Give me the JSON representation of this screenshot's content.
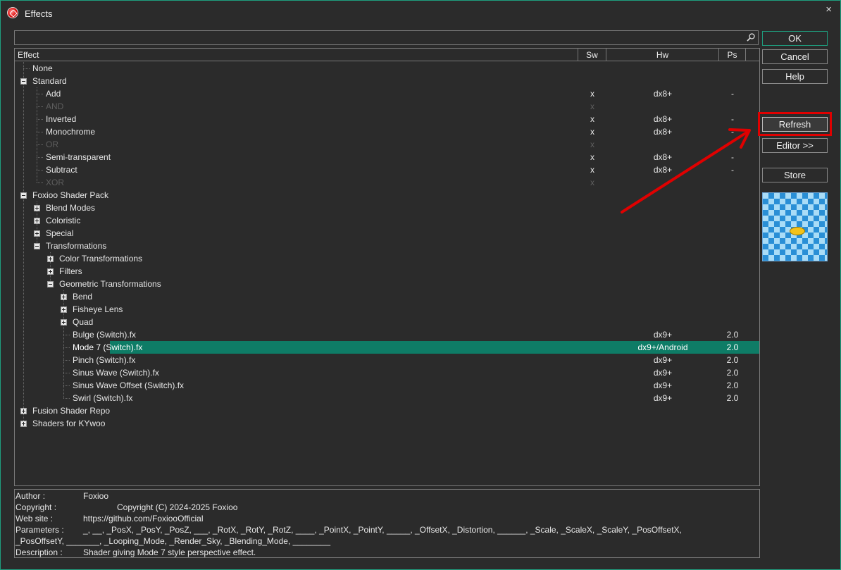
{
  "window": {
    "title": "Effects",
    "close_glyph": "×"
  },
  "search": {
    "value": "",
    "placeholder": "",
    "icon": "search-icon"
  },
  "columns": {
    "effect": "Effect",
    "sw": "Sw",
    "hw": "Hw",
    "ps": "Ps"
  },
  "tree": [
    {
      "label": "None",
      "level": 0,
      "toggle": "none",
      "sw": "",
      "hw": "",
      "ps": ""
    },
    {
      "label": "Standard",
      "level": 0,
      "toggle": "minus",
      "sw": "",
      "hw": "",
      "ps": ""
    },
    {
      "label": "Add",
      "level": 1,
      "toggle": "none",
      "sw": "x",
      "hw": "dx8+",
      "ps": "-"
    },
    {
      "label": "AND",
      "level": 1,
      "toggle": "none",
      "sw": "x",
      "hw": "",
      "ps": "",
      "disabled": true
    },
    {
      "label": "Inverted",
      "level": 1,
      "toggle": "none",
      "sw": "x",
      "hw": "dx8+",
      "ps": "-"
    },
    {
      "label": "Monochrome",
      "level": 1,
      "toggle": "none",
      "sw": "x",
      "hw": "dx8+",
      "ps": "-"
    },
    {
      "label": "OR",
      "level": 1,
      "toggle": "none",
      "sw": "x",
      "hw": "",
      "ps": "",
      "disabled": true
    },
    {
      "label": "Semi-transparent",
      "level": 1,
      "toggle": "none",
      "sw": "x",
      "hw": "dx8+",
      "ps": "-"
    },
    {
      "label": "Subtract",
      "level": 1,
      "toggle": "none",
      "sw": "x",
      "hw": "dx8+",
      "ps": "-"
    },
    {
      "label": "XOR",
      "level": 1,
      "toggle": "none",
      "sw": "x",
      "hw": "",
      "ps": "",
      "disabled": true
    },
    {
      "label": "Foxioo Shader Pack",
      "level": 0,
      "toggle": "minus",
      "sw": "",
      "hw": "",
      "ps": ""
    },
    {
      "label": "Blend Modes",
      "level": 1,
      "toggle": "plus",
      "sw": "",
      "hw": "",
      "ps": ""
    },
    {
      "label": "Coloristic",
      "level": 1,
      "toggle": "plus",
      "sw": "",
      "hw": "",
      "ps": ""
    },
    {
      "label": "Special",
      "level": 1,
      "toggle": "plus",
      "sw": "",
      "hw": "",
      "ps": ""
    },
    {
      "label": "Transformations",
      "level": 1,
      "toggle": "minus",
      "sw": "",
      "hw": "",
      "ps": ""
    },
    {
      "label": "Color Transformations",
      "level": 2,
      "toggle": "plus",
      "sw": "",
      "hw": "",
      "ps": ""
    },
    {
      "label": "Filters",
      "level": 2,
      "toggle": "plus",
      "sw": "",
      "hw": "",
      "ps": ""
    },
    {
      "label": "Geometric Transformations",
      "level": 2,
      "toggle": "minus",
      "sw": "",
      "hw": "",
      "ps": ""
    },
    {
      "label": "Bend",
      "level": 3,
      "toggle": "plus",
      "sw": "",
      "hw": "",
      "ps": ""
    },
    {
      "label": "Fisheye Lens",
      "level": 3,
      "toggle": "plus",
      "sw": "",
      "hw": "",
      "ps": ""
    },
    {
      "label": "Quad",
      "level": 3,
      "toggle": "plus",
      "sw": "",
      "hw": "",
      "ps": ""
    },
    {
      "label": "Bulge (Switch).fx",
      "level": 3,
      "toggle": "none",
      "sw": "",
      "hw": "dx9+",
      "ps": "2.0"
    },
    {
      "label": "Mode 7 (Switch).fx",
      "level": 3,
      "toggle": "none",
      "sw": "",
      "hw": "dx9+/Android",
      "ps": "2.0",
      "selected": true
    },
    {
      "label": "Pinch (Switch).fx",
      "level": 3,
      "toggle": "none",
      "sw": "",
      "hw": "dx9+",
      "ps": "2.0"
    },
    {
      "label": "Sinus Wave (Switch).fx",
      "level": 3,
      "toggle": "none",
      "sw": "",
      "hw": "dx9+",
      "ps": "2.0"
    },
    {
      "label": "Sinus Wave Offset (Switch).fx",
      "level": 3,
      "toggle": "none",
      "sw": "",
      "hw": "dx9+",
      "ps": "2.0"
    },
    {
      "label": "Swirl (Switch).fx",
      "level": 3,
      "toggle": "none",
      "sw": "",
      "hw": "dx9+",
      "ps": "2.0"
    },
    {
      "label": "Fusion Shader Repo",
      "level": 0,
      "toggle": "plus",
      "sw": "",
      "hw": "",
      "ps": ""
    },
    {
      "label": "Shaders for KYwoo",
      "level": 0,
      "toggle": "plus",
      "sw": "",
      "hw": "",
      "ps": ""
    }
  ],
  "info": {
    "author_label": "Author :",
    "author": "Foxioo",
    "copyright_label": "Copyright :",
    "copyright": "Copyright (C) 2024-2025 Foxioo",
    "website_label": "Web site :",
    "website": "https://github.com/FoxiooOfficial",
    "parameters_label": "Parameters :",
    "parameters_line1": "_, __, _PosX, _PosY, _PosZ, ___, _RotX, _RotY, _RotZ, ____, _PointX, _PointY, _____, _OffsetX, _Distortion, ______, _Scale, _ScaleX, _ScaleY, _PosOffsetX,",
    "parameters_line2": "_PosOffsetY, _______, _Looping_Mode, _Render_Sky, _Blending_Mode, ________",
    "description_label": "Description :",
    "description": "Shader giving Mode 7 style perspective effect."
  },
  "buttons": {
    "ok": "OK",
    "cancel": "Cancel",
    "help": "Help",
    "refresh": "Refresh",
    "editor": "Editor >>",
    "store": "Store"
  },
  "annotation": {
    "highlight_color": "#e00000"
  }
}
